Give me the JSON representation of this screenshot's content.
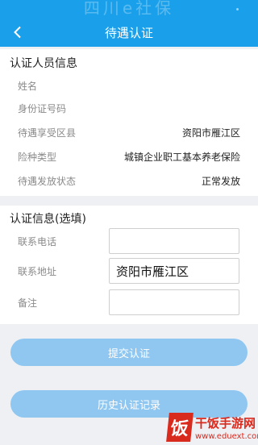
{
  "header": {
    "ghost_title": "四川e社保",
    "title": "待遇认证"
  },
  "person_info": {
    "title": "认证人员信息",
    "rows": [
      {
        "label": "姓名",
        "value": ""
      },
      {
        "label": "身份证号码",
        "value": ""
      },
      {
        "label": "待遇享受区县",
        "value": "资阳市雁江区"
      },
      {
        "label": "险种类型",
        "value": "城镇企业职工基本养老保险"
      },
      {
        "label": "待遇发放状态",
        "value": "正常发放"
      }
    ]
  },
  "auth_info": {
    "title": "认证信息(选填)",
    "phone": {
      "label": "联系电话",
      "value": ""
    },
    "address": {
      "label": "联系地址",
      "value": "资阳市雁江区"
    },
    "note": {
      "label": "备注",
      "value": ""
    }
  },
  "buttons": {
    "submit": "提交认证",
    "history": "历史认证记录"
  },
  "watermark": {
    "logo_char": "饭",
    "name": "干饭手游网",
    "url": "www.eduext.com"
  },
  "colors": {
    "primary": "#1aa0ea",
    "button_disabled": "#8fc7f1",
    "watermark": "#d92a1e"
  }
}
